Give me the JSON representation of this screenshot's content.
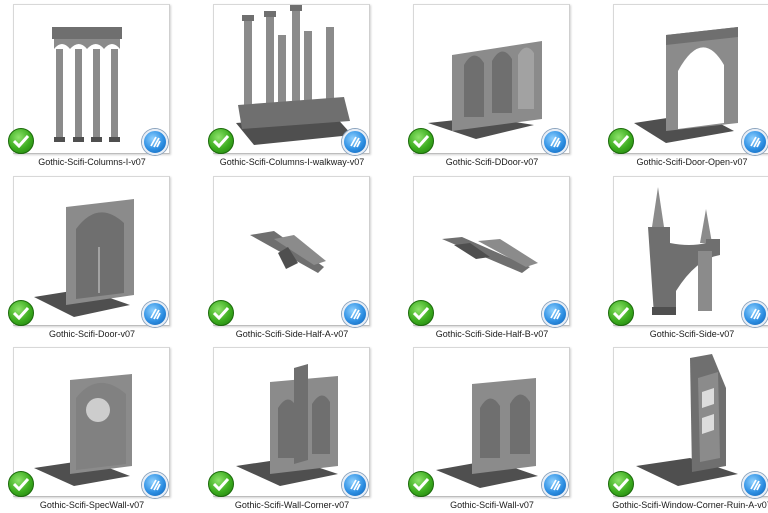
{
  "items": [
    {
      "label": "Gothic-Scifi-Columns-I-v07"
    },
    {
      "label": "Gothic-Scifi-Columns-I-walkway-v07"
    },
    {
      "label": "Gothic-Scifi-DDoor-v07"
    },
    {
      "label": "Gothic-Scifi-Door-Open-v07"
    },
    {
      "label": "Gothic-Scifi-Door-v07"
    },
    {
      "label": "Gothic-Scifi-Side-Half-A-v07"
    },
    {
      "label": "Gothic-Scifi-Side-Half-B-v07"
    },
    {
      "label": "Gothic-Scifi-Side-v07"
    },
    {
      "label": "Gothic-Scifi-SpecWall-v07"
    },
    {
      "label": "Gothic-Scifi-Wall-Corner-v07"
    },
    {
      "label": "Gothic-Scifi-Wall-v07"
    },
    {
      "label": "Gothic-Scifi-Window-Corner-Ruin-A-v07"
    }
  ],
  "icons": {
    "status": "green-checkmark-icon",
    "app_badge": "slicer-app-badge-icon"
  },
  "colors": {
    "check_green": "#3cac1f",
    "badge_blue": "#2d8fe3",
    "model_gray": "#8b8b8b"
  }
}
